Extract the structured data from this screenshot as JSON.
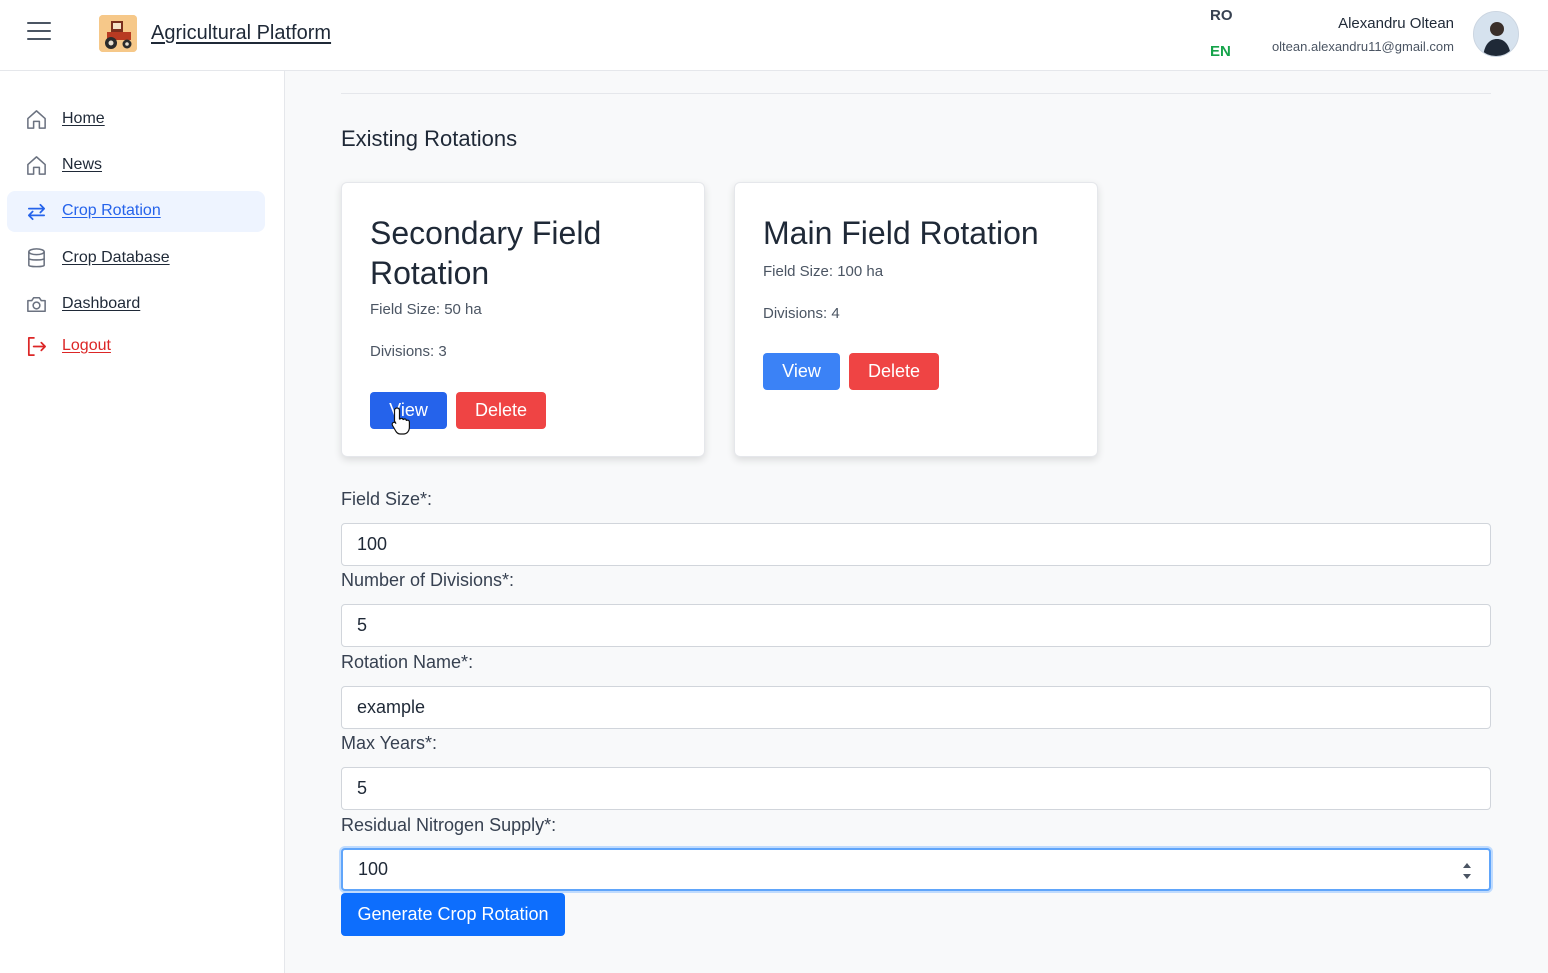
{
  "header": {
    "app_title": "Agricultural Platform",
    "lang_ro": "RO",
    "lang_en": "EN",
    "user_name": "Alexandru Oltean",
    "user_email": "oltean.alexandru11@gmail.com"
  },
  "sidebar": {
    "items": [
      {
        "label": "Home",
        "icon": "home-icon"
      },
      {
        "label": "News",
        "icon": "home-icon"
      },
      {
        "label": "Crop Rotation",
        "icon": "rotation-arrows-icon",
        "active": true
      },
      {
        "label": "Crop Database",
        "icon": "database-icon"
      },
      {
        "label": "Dashboard",
        "icon": "camera-icon"
      },
      {
        "label": "Logout",
        "icon": "logout-icon"
      }
    ]
  },
  "main": {
    "section_title": "Existing Rotations",
    "rotations": [
      {
        "name": "Secondary Field Rotation",
        "field_size": "Field Size: 50 ha",
        "divisions": "Divisions: 3",
        "view_label": "View",
        "delete_label": "Delete"
      },
      {
        "name": "Main Field Rotation",
        "field_size": "Field Size: 100 ha",
        "divisions": "Divisions: 4",
        "view_label": "View",
        "delete_label": "Delete"
      }
    ],
    "form": {
      "field_size_label": "Field Size*:",
      "field_size_value": "100",
      "divisions_label": "Number of Divisions*:",
      "divisions_value": "5",
      "rotation_name_label": "Rotation Name*:",
      "rotation_name_value": "example",
      "max_years_label": "Max Years*:",
      "max_years_value": "5",
      "nitrogen_label": "Residual Nitrogen Supply*:",
      "nitrogen_value": "100",
      "generate_label": "Generate Crop Rotation"
    }
  },
  "colors": {
    "primary": "#3b82f6",
    "primary_pressed": "#2563eb",
    "danger": "#ef4444",
    "active_lang": "#16a34a",
    "logout": "#dc2626"
  }
}
